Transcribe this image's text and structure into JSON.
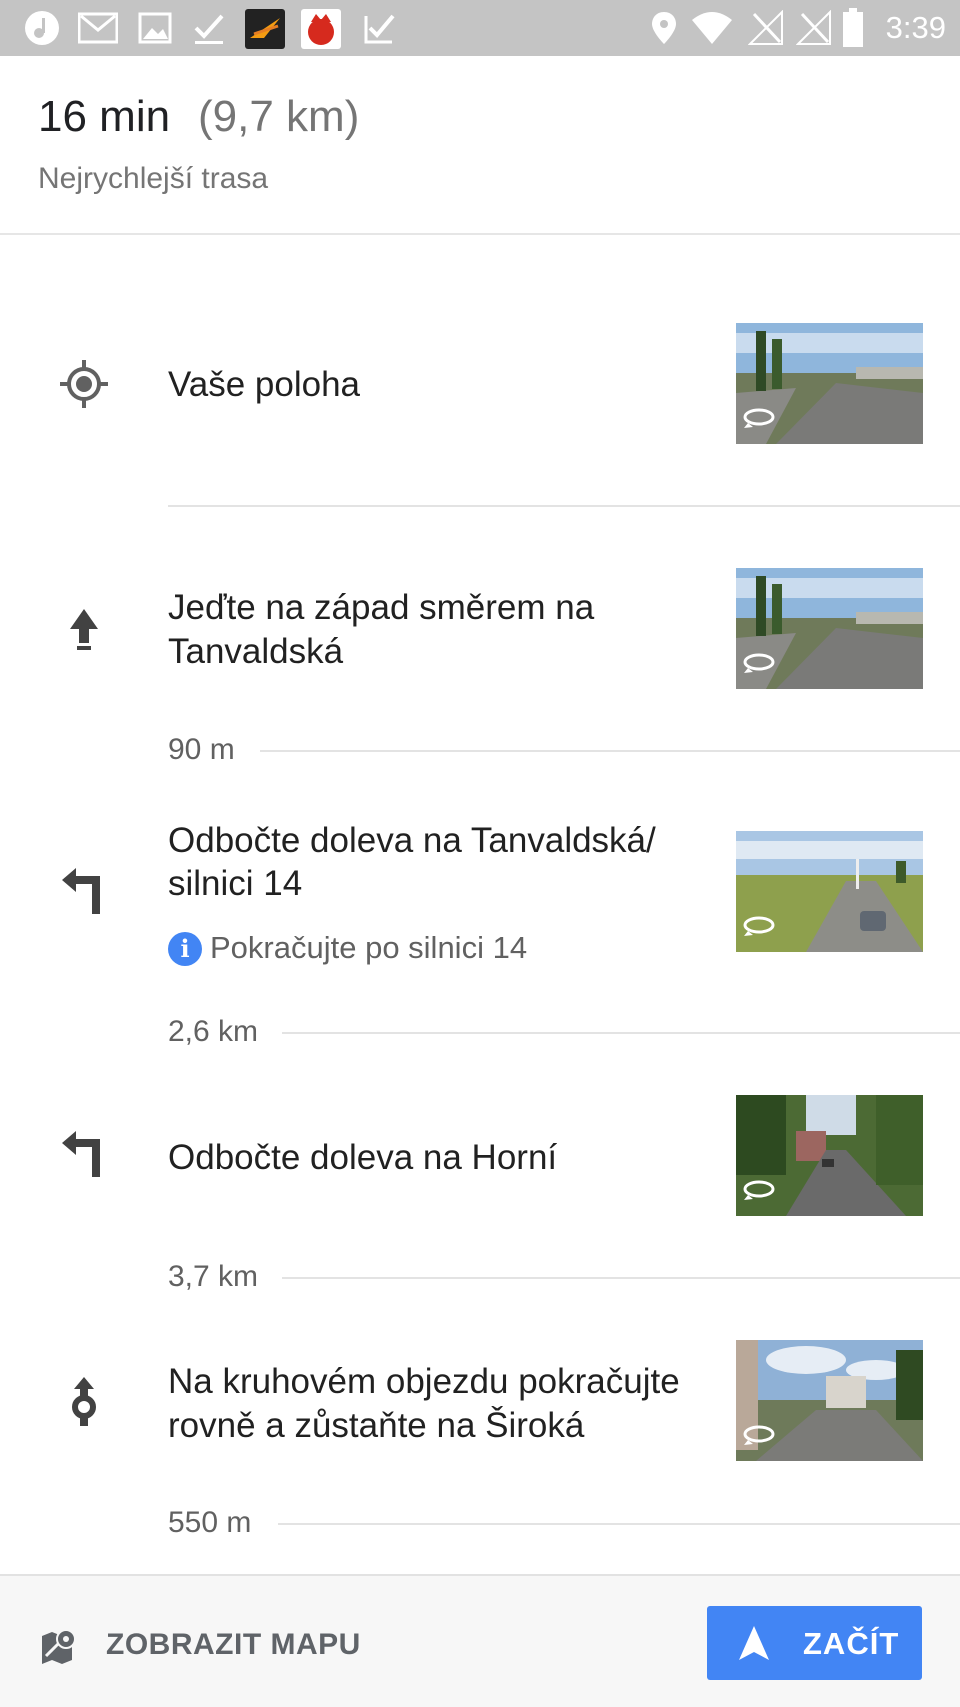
{
  "status_bar": {
    "time": "3:39",
    "left_icons": [
      "music-icon",
      "gmail-icon",
      "gallery-icon",
      "tasks-check-icon",
      "app-swift-icon",
      "antutu-icon",
      "checkmark-app-icon"
    ],
    "right_icons": [
      "location-icon",
      "wifi-icon",
      "signal-off-icon",
      "signal-off-icon",
      "battery-icon"
    ]
  },
  "header": {
    "duration": "16 min",
    "distance": "(9,7 km)",
    "route_type": "Nejrychlejší trasa"
  },
  "steps": [
    {
      "icon": "my-location-icon",
      "text": "Vaše poloha"
    },
    {
      "icon": "straight-arrow-icon",
      "text_line1": "Jeďte na západ směrem na",
      "text_line2": "Tanvaldská"
    },
    {
      "icon": "turn-left-icon",
      "text_line1": "Odbočte doleva na Tanvaldská/",
      "text_line2": "silnici 14",
      "note": "Pokračujte po silnici 14"
    },
    {
      "icon": "turn-left-icon",
      "text": "Odbočte doleva na Horní"
    },
    {
      "icon": "roundabout-straight-icon",
      "text_line1": "Na kruhovém objezdu pokračujte",
      "text_line2": "rovně a zůstaňte na Široká"
    }
  ],
  "distances": [
    "90 m",
    "2,6 km",
    "3,7 km",
    "550 m"
  ],
  "bottom_bar": {
    "map_label": "ZOBRAZIT MAPU",
    "start_label": "ZAČÍT"
  },
  "colors": {
    "accent": "#4285f4",
    "status_bar": "#c4c4c4",
    "secondary_text": "#757575"
  }
}
